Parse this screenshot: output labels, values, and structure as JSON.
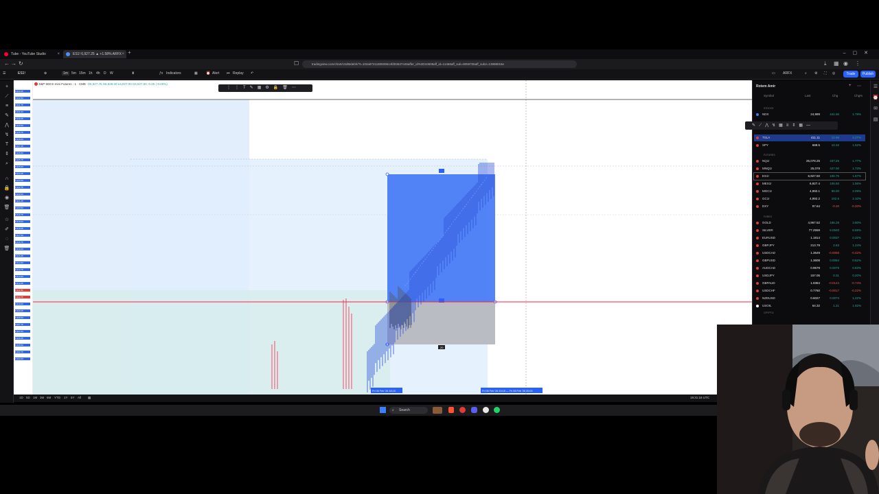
{
  "browser": {
    "tabs": [
      {
        "title": "Tube - YouTube Studio",
        "favicon_color": "#ff0033"
      },
      {
        "title": "ES1! 6,927.25 ▲ +1.58% ARFX",
        "favicon_color": "#4c8dff"
      }
    ],
    "new_tab_icon": "plus-icon",
    "url": "tradingview.com/chart/cSdMdebh/?t=102a9721180509614fd03637445affer_id%3D10608aff_id=11468aff_sub=9059706aff_sub2=13998016e"
  },
  "tv_toolbar": {
    "symbol": "ES1!",
    "timeframes": [
      "1m",
      "5m",
      "15m",
      "1h",
      "4h",
      "D",
      "W"
    ],
    "indicators_label": "Indicators",
    "alert_label": "Alert",
    "replay_label": "Replay",
    "layout_name": "ARFX",
    "trade_label": "Trade",
    "publish_label": "Publish"
  },
  "chart": {
    "title": "S&P 500 E-mini Futures · 1 · CME",
    "ohlc": "O6,927.75 H6,928.00 L6,927.00 C6,927.50 -0.25 (-0.00%)",
    "price_labels": [
      "6,933.25",
      "6,932.50",
      "6,931.75",
      "6,931.00",
      "6,930.25",
      "6,929.50",
      "6,928.75",
      "6,928.00",
      "6,927.25",
      "6,926.50",
      "6,925.75",
      "6,925.00",
      "6,924.25",
      "6,923.50",
      "6,922.75",
      "6,922.00",
      "6,921.25",
      "6,920.50",
      "6,919.75",
      "6,919.00",
      "6,918.25",
      "6,917.50",
      "6,916.75",
      "6,916.00",
      "6,915.25",
      "6,914.50",
      "6,913.75",
      "6,913.00",
      "6,912.25",
      "6,911.50",
      "6,910.75",
      "6,910.00",
      "6,909.25",
      "6,908.50",
      "6,907.75",
      "6,907.00",
      "6,906.25",
      "6,905.50",
      "6,904.75",
      "6,904.00"
    ],
    "crosshair_date_label": "Fri 06 Feb '26 18:15",
    "range_date_label": "Fri 06 Feb '26 19:15 — Fri 06 Feb '26 20:00",
    "position_box_label": "20",
    "accent": "#2962ff",
    "red_line": "#ff1f3c"
  },
  "bottom_bar": {
    "ranges": [
      "1D",
      "5D",
      "1M",
      "3M",
      "6M",
      "YTD",
      "1Y",
      "5Y",
      "All"
    ],
    "time": "19:31:18 UTC"
  },
  "watchlist": {
    "title": "Rotem Amir",
    "columns": {
      "symbol": "Symbol",
      "last": "Last",
      "chg": "Chg",
      "chgp": "Chg%"
    },
    "sections": {
      "stocks": "STOCKS",
      "futures": "FUTURES",
      "forex": "FOREX",
      "crypto": "CRYPTO"
    },
    "stocks": [
      {
        "sym": "NDX",
        "last": "24,989",
        "chg": "441.56",
        "chgp": "1.79%",
        "color": "#26a69a",
        "dot": "#3d7eff"
      },
      {
        "sym": "TSLA",
        "last": "411.11",
        "chg": "14.98",
        "chgp": "4.27%",
        "color": "#26a69a",
        "dot": "#e53935"
      },
      {
        "sym": "SPY",
        "last": "688.5",
        "chg": "10.32",
        "chgp": "1.52%",
        "color": "#26a69a",
        "dot": "#e53935"
      }
    ],
    "futures": [
      {
        "sym": "NQ1!",
        "last": "25,078.25",
        "chg": "437.25",
        "chgp": "1.77%",
        "color": "#26a69a",
        "dot": "#e53935"
      },
      {
        "sym": "MNQ1!",
        "last": "25,078",
        "chg": "427.00",
        "chgp": "1.73%",
        "color": "#26a69a",
        "dot": "#e53935"
      },
      {
        "sym": "ES1!",
        "last": "6,927.50",
        "chg": "106.75",
        "chgp": "1.57%",
        "color": "#26a69a",
        "dot": "#e53935"
      },
      {
        "sym": "MES1!",
        "last": "6,927.4",
        "chg": "106.50",
        "chgp": "1.56%",
        "color": "#26a69a",
        "dot": "#e53935"
      },
      {
        "sym": "MGC1!",
        "last": "4,992.1",
        "chg": "96.00",
        "chgp": "2.09%",
        "color": "#26a69a",
        "dot": "#e53935"
      },
      {
        "sym": "GC1!",
        "last": "4,992.2",
        "chg": "102.6",
        "chgp": "2.10%",
        "color": "#26a69a",
        "dot": "#e53935"
      },
      {
        "sym": "DXY",
        "last": "97.64",
        "chg": "-0.20",
        "chgp": "-0.20%",
        "color": "#ef5350",
        "dot": "#e53935"
      }
    ],
    "forex": [
      {
        "sym": "GOLD",
        "last": "4,967.52",
        "chg": "186.29",
        "chgp": "3.90%",
        "color": "#26a69a",
        "dot": "#e53935"
      },
      {
        "sym": "SILVER",
        "last": "77.2559",
        "chg": "6.0940",
        "chgp": "8.59%",
        "color": "#26a69a",
        "dot": "#e53935"
      },
      {
        "sym": "EURUSD",
        "last": "1.1814",
        "chg": "0.0037",
        "chgp": "0.32%",
        "color": "#26a69a",
        "dot": "#e53935"
      },
      {
        "sym": "GBPJPY",
        "last": "213.79",
        "chg": "2.63",
        "chgp": "1.24%",
        "color": "#26a69a",
        "dot": "#e53935"
      },
      {
        "sym": "USDCAD",
        "last": "1.3649",
        "chg": "-0.0058",
        "chgp": "-0.42%",
        "color": "#ef5350",
        "dot": "#e53935"
      },
      {
        "sym": "GBPUSD",
        "last": "1.3608",
        "chg": "0.0084",
        "chgp": "0.62%",
        "color": "#26a69a",
        "dot": "#e53935"
      },
      {
        "sym": "AUDCAD",
        "last": "0.9579",
        "chg": "0.0079",
        "chgp": "0.83%",
        "color": "#26a69a",
        "dot": "#e53935"
      },
      {
        "sym": "USDJPY",
        "last": "157.05",
        "chg": "0.31",
        "chgp": "0.20%",
        "color": "#26a69a",
        "dot": "#e53935"
      },
      {
        "sym": "GBPAUD",
        "last": "1.9384",
        "chg": "-0.0144",
        "chgp": "-0.74%",
        "color": "#ef5350",
        "dot": "#e53935"
      },
      {
        "sym": "USDCHF",
        "last": "0.7760",
        "chg": "-0.0017",
        "chgp": "-0.22%",
        "color": "#ef5350",
        "dot": "#e53935"
      },
      {
        "sym": "NZDUSD",
        "last": "0.6027",
        "chg": "0.0073",
        "chgp": "1.22%",
        "color": "#26a69a",
        "dot": "#e53935"
      },
      {
        "sym": "USOIL",
        "last": "64.32",
        "chg": "1.21",
        "chgp": "1.92%",
        "color": "#26a69a",
        "dot": "#ffffff"
      }
    ]
  },
  "taskbar": {
    "search_label": "Search"
  }
}
